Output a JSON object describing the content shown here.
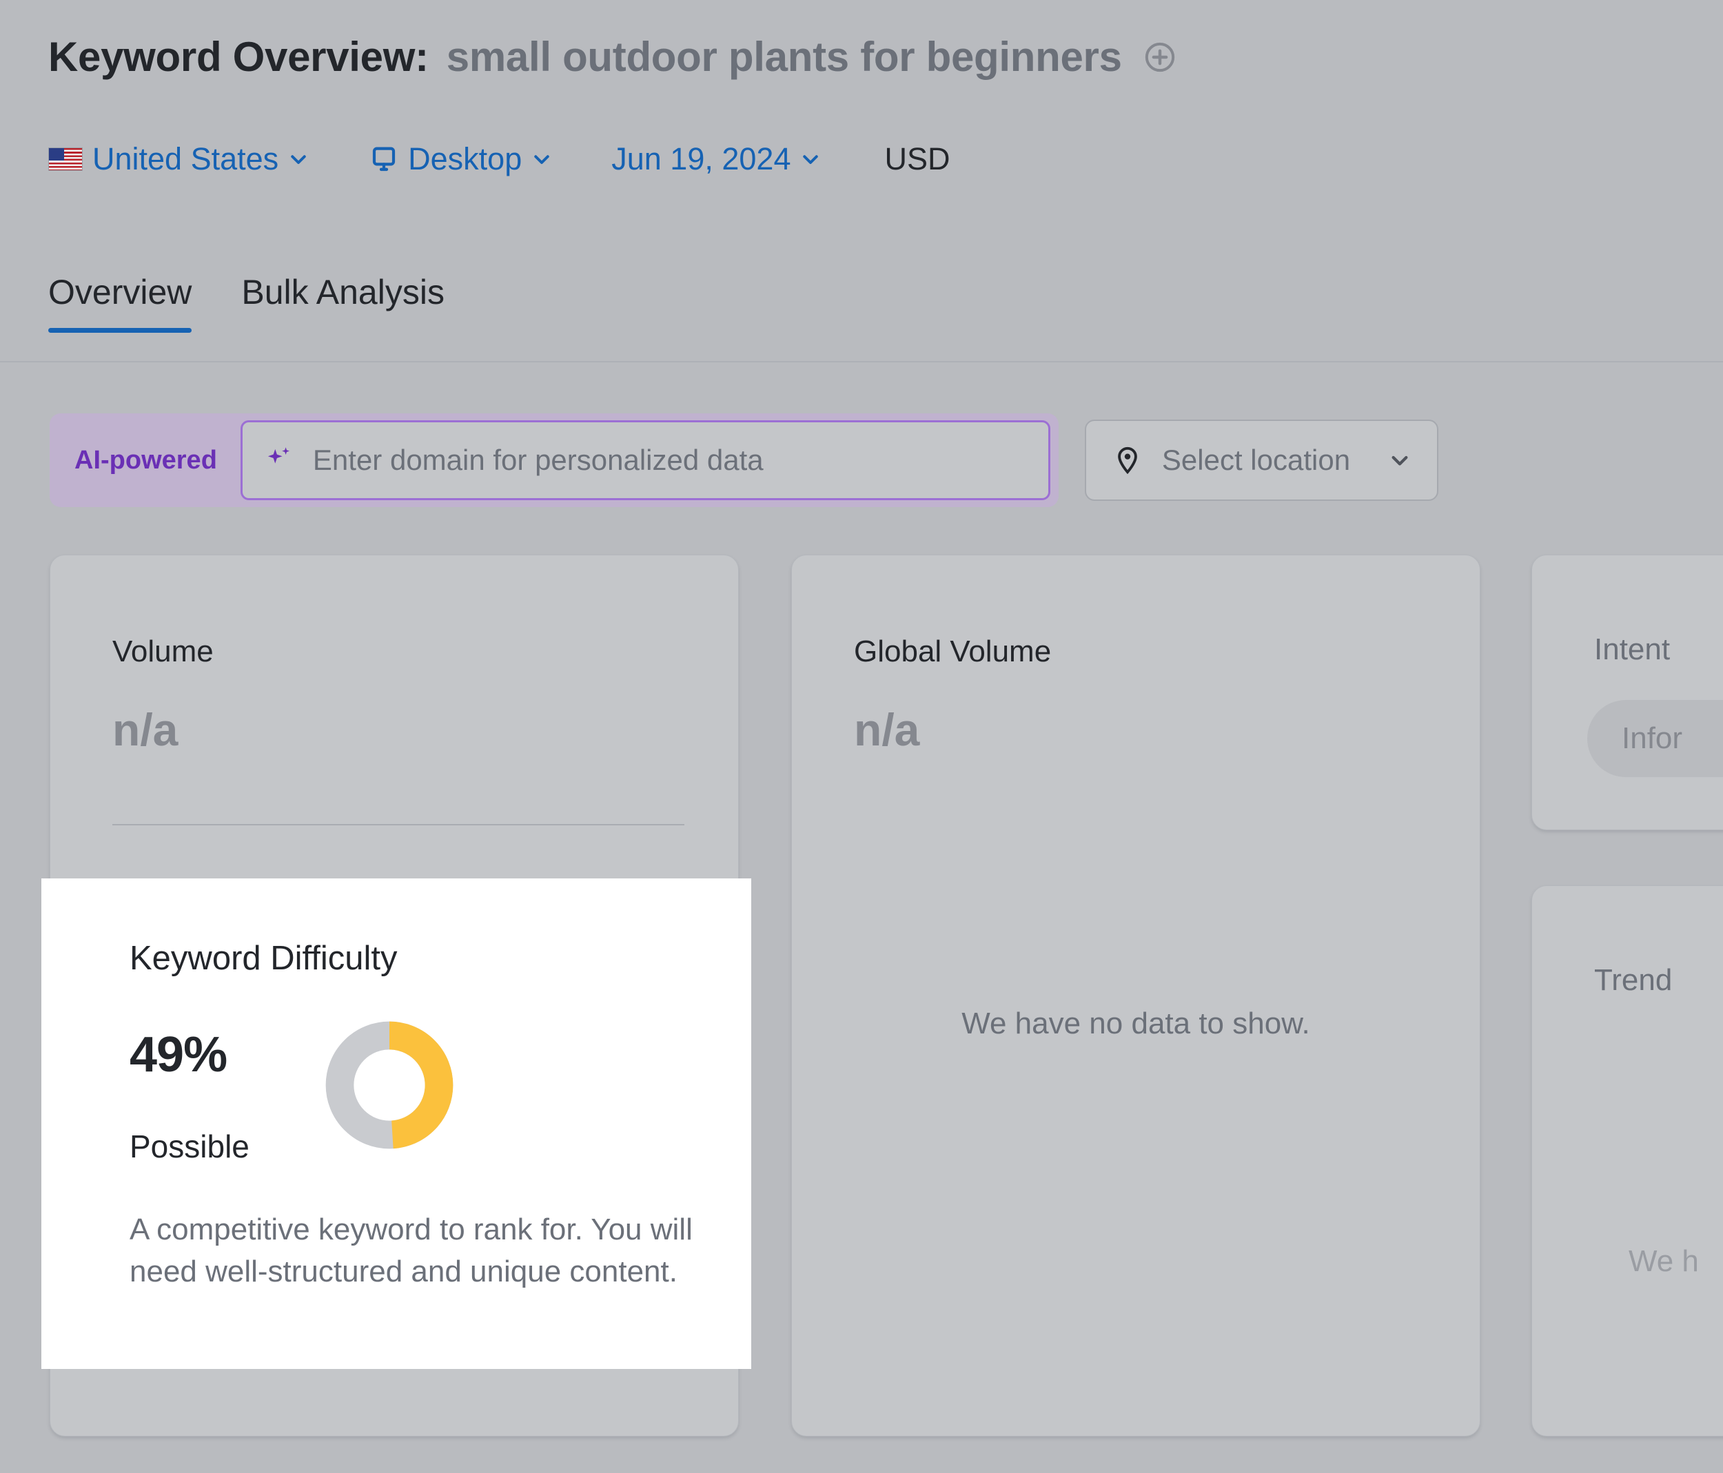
{
  "header": {
    "title_prefix": "Keyword Overview:",
    "keyword": "small outdoor plants for beginners",
    "add_icon": "plus-circle-icon"
  },
  "meta": {
    "country": "United States",
    "country_flag_icon": "us-flag-icon",
    "device": "Desktop",
    "device_icon": "desktop-monitor-icon",
    "date": "Jun 19, 2024",
    "currency": "USD",
    "chevron_icon": "chevron-down-icon"
  },
  "tabs": [
    {
      "label": "Overview",
      "active": true
    },
    {
      "label": "Bulk Analysis",
      "active": false
    }
  ],
  "ai_bar": {
    "badge": "AI-powered",
    "sparkle_icon": "sparkle-icon",
    "domain_placeholder": "Enter domain for personalized data",
    "location_label": "Select location",
    "location_icon": "map-pin-icon",
    "location_chevron_icon": "chevron-down-icon"
  },
  "cards": {
    "volume": {
      "title": "Volume",
      "value": "n/a"
    },
    "global_volume": {
      "title": "Global Volume",
      "value": "n/a",
      "empty_message": "We have no data to show."
    },
    "intent": {
      "title": "Intent",
      "pill": "Infor"
    },
    "trend": {
      "title": "Trend",
      "empty_message": "We h"
    }
  },
  "keyword_difficulty_tooltip": {
    "title": "Keyword Difficulty",
    "percent": "49%",
    "rating": "Possible",
    "description": "A competitive keyword to rank for. You will need well-structured and unique content.",
    "donut_value": 49,
    "donut_fill_color": "#fbc13d",
    "donut_track_color": "#c9cbcf"
  },
  "colors": {
    "page_background": "#b9bbbf",
    "card_background": "#c4c6c9",
    "link_blue": "#1662b3",
    "ai_purple": "#6a30b5",
    "ai_badge_background": "#c0b2cf",
    "tooltip_background": "#ffffff"
  }
}
